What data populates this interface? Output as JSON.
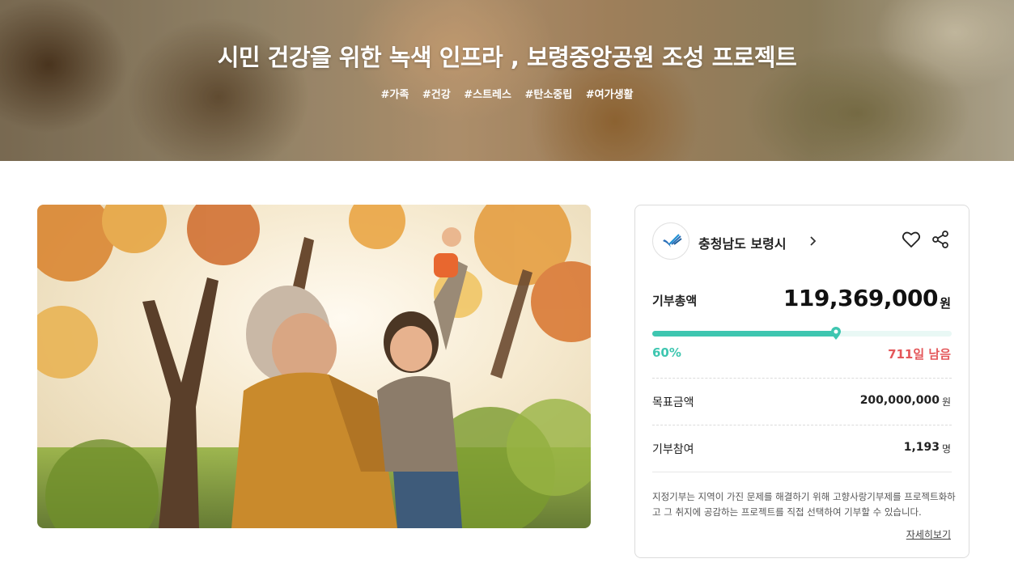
{
  "hero": {
    "title": "시민 건강을 위한 녹색 인프라 , 보령중앙공원 조성 프로젝트",
    "tags": [
      "#가족",
      "#건강",
      "#스트레스",
      "#탄소중립",
      "#여가생활"
    ]
  },
  "photo": {
    "icon": "family-autumn-photo"
  },
  "card": {
    "organization": {
      "name": "충청남도 보령시",
      "chevron": "›",
      "logo_icon": "boryeong-city-logo"
    },
    "actions": {
      "like_icon": "heart-icon",
      "share_icon": "share-icon"
    },
    "total": {
      "label": "기부총액",
      "amount": "119,369,000",
      "unit": "원"
    },
    "progress": {
      "percent_value": 60,
      "percent_label": "60%",
      "days_left": "711일 남음",
      "color_fill": "#3ec6b0",
      "color_days": "#e4575a"
    },
    "goal": {
      "label": "목표금액",
      "value": "200,000,000",
      "unit": "원"
    },
    "participants": {
      "label": "기부참여",
      "value": "1,193",
      "unit": "명"
    },
    "notice": "지정기부는 지역이 가진 문제를 해결하기 위해 고향사랑기부제를 프로젝트화하고 그 취지에 공감하는 프로젝트를 직접 선택하여 기부할 수 있습니다.",
    "more_link": "자세히보기"
  }
}
